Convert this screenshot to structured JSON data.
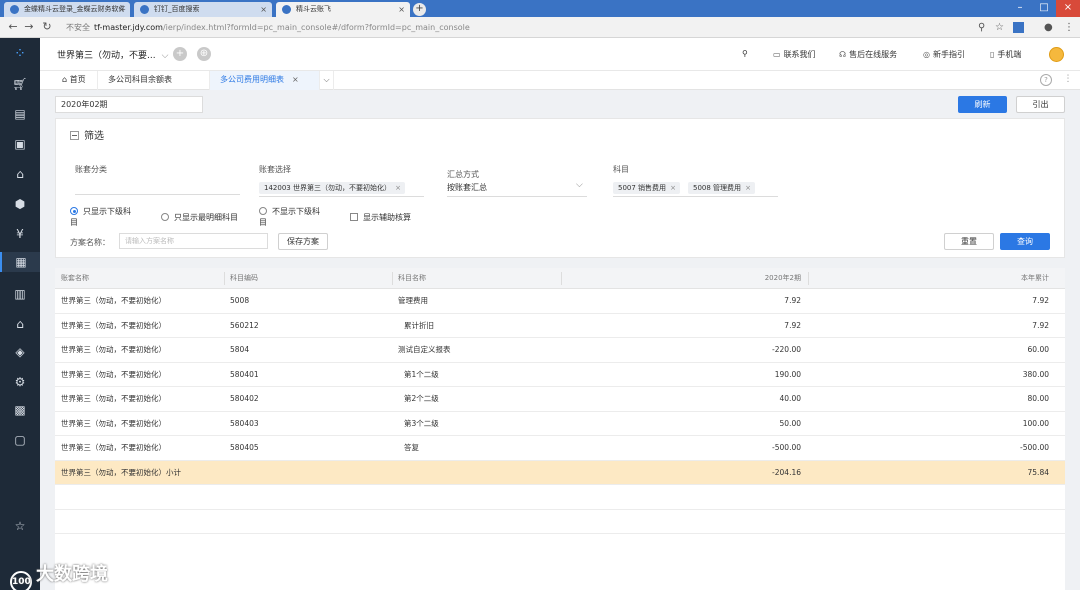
{
  "browser": {
    "tabs": [
      {
        "label": "金蝶精斗云登录_金蝶云财务软件"
      },
      {
        "label": "钉钉_百度搜索"
      },
      {
        "label": "精斗云账飞"
      }
    ],
    "new_tab": "+",
    "insecure_label": "不安全",
    "url_host": "tf-master.jdy.com",
    "url_path": "/ierp/index.html?formId=pc_main_console#/dform?formId=pc_main_console"
  },
  "appbar": {
    "account": "世界第三（勿动，不要...",
    "links": [
      {
        "label": "联系我们",
        "icon": "chat-icon"
      },
      {
        "label": "售后在线服务",
        "icon": "headset-icon"
      },
      {
        "label": "新手指引",
        "icon": "compass-icon"
      },
      {
        "label": "手机端",
        "icon": "mobile-icon"
      }
    ]
  },
  "page_tabs": {
    "home": "首页",
    "tab1": "多公司科目余额表",
    "tab2": "多公司费用明细表"
  },
  "toolbar": {
    "period": "2020年02期",
    "refresh": "刷新",
    "export": "引出"
  },
  "filter": {
    "title": "筛选",
    "account_category_label": "账套分类",
    "account_select_label": "账套选择",
    "account_chip": "142003 世界第三（勿动，不要初始化）",
    "summary_label": "汇总方式",
    "summary_value": "按账套汇总",
    "subject_label": "科目",
    "subject_chips": [
      "5007 销售费用",
      "5008 管理费用"
    ],
    "radio_1": "只显示下级科",
    "radio_1b": "目",
    "radio_2": "只显示最明细科目",
    "radio_3": "不显示下级科",
    "radio_3b": "目",
    "checkbox_aux": "显示辅助核算",
    "plan_label": "方案名称：",
    "plan_placeholder": "请输入方案名称",
    "save_plan": "保存方案",
    "reset": "重置",
    "query": "查询"
  },
  "table": {
    "headers": {
      "account": "账套名称",
      "code": "科目编码",
      "name": "科目名称",
      "period": "2020年2期",
      "ytd": "本年累计"
    },
    "rows": [
      {
        "account": "世界第三（勿动，不要初始化）",
        "code": "5008",
        "name": "管理费用",
        "period": "7.92",
        "ytd": "7.92"
      },
      {
        "account": "世界第三（勿动，不要初始化）",
        "code": "560212",
        "name": "累计折旧",
        "period": "7.92",
        "ytd": "7.92"
      },
      {
        "account": "世界第三（勿动，不要初始化）",
        "code": "5804",
        "name": "测试自定义报表",
        "period": "-220.00",
        "ytd": "60.00"
      },
      {
        "account": "世界第三（勿动，不要初始化）",
        "code": "580401",
        "name": "第1个二级",
        "period": "190.00",
        "ytd": "380.00"
      },
      {
        "account": "世界第三（勿动，不要初始化）",
        "code": "580402",
        "name": "第2个二级",
        "period": "40.00",
        "ytd": "80.00"
      },
      {
        "account": "世界第三（勿动，不要初始化）",
        "code": "580403",
        "name": "第3个二级",
        "period": "50.00",
        "ytd": "100.00"
      },
      {
        "account": "世界第三（勿动，不要初始化）",
        "code": "580405",
        "name": "答复",
        "period": "-500.00",
        "ytd": "-500.00"
      }
    ],
    "total": {
      "account": "世界第三（勿动，不要初始化）小计",
      "period": "-204.16",
      "ytd": "75.84"
    }
  },
  "watermark": "大数跨境",
  "colors": {
    "accent": "#2b78e4",
    "total_row": "#fde9c4",
    "rail": "#1e2a38"
  }
}
